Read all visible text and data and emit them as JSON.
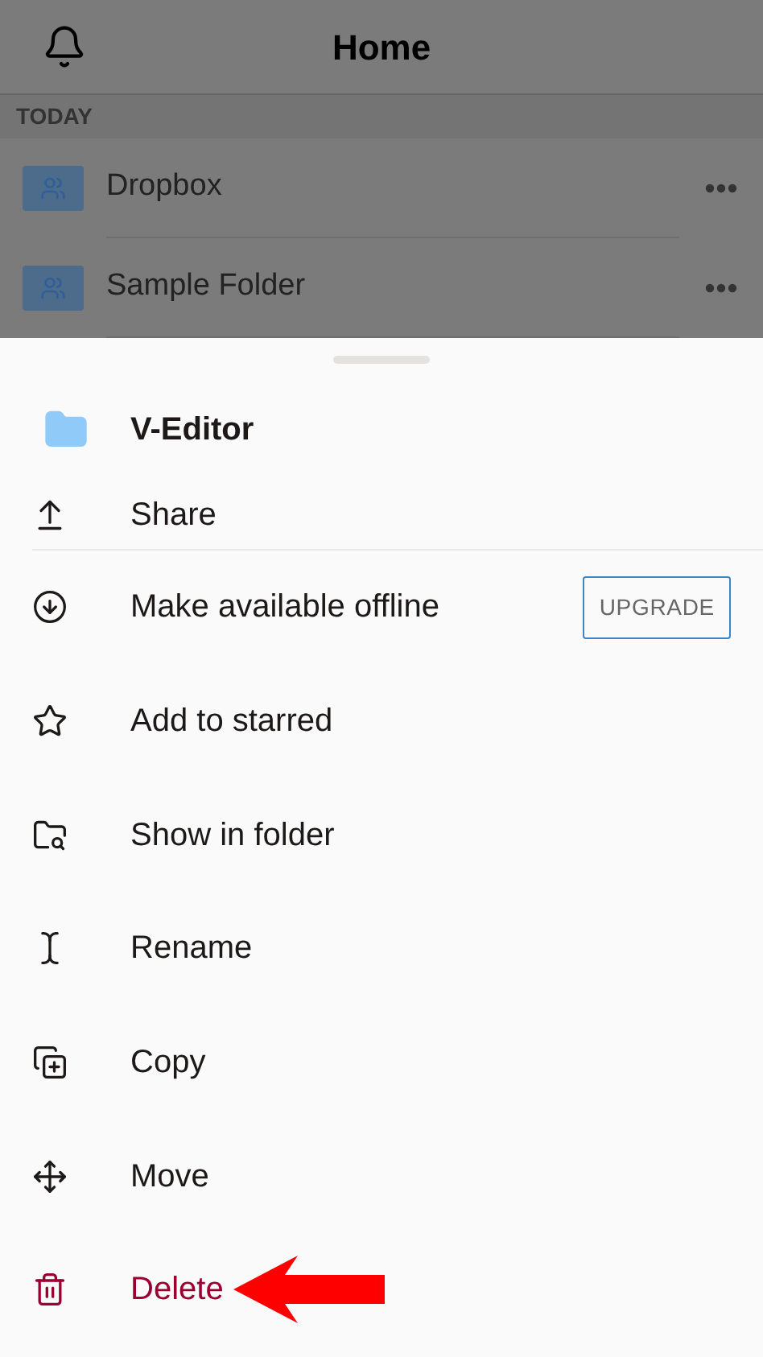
{
  "header": {
    "title": "Home"
  },
  "section": "TODAY",
  "files": [
    {
      "name": "Dropbox"
    },
    {
      "name": "Sample Folder"
    }
  ],
  "sheet": {
    "title": "V-Editor",
    "items": [
      {
        "label": "Share",
        "kind": "normal"
      },
      {
        "label": "Make available offline",
        "kind": "normal",
        "badge": "UPGRADE"
      },
      {
        "label": "Add to starred",
        "kind": "normal"
      },
      {
        "label": "Show in folder",
        "kind": "normal"
      },
      {
        "label": "Rename",
        "kind": "normal"
      },
      {
        "label": "Copy",
        "kind": "normal"
      },
      {
        "label": "Move",
        "kind": "normal"
      },
      {
        "label": "Delete",
        "kind": "danger"
      }
    ]
  }
}
